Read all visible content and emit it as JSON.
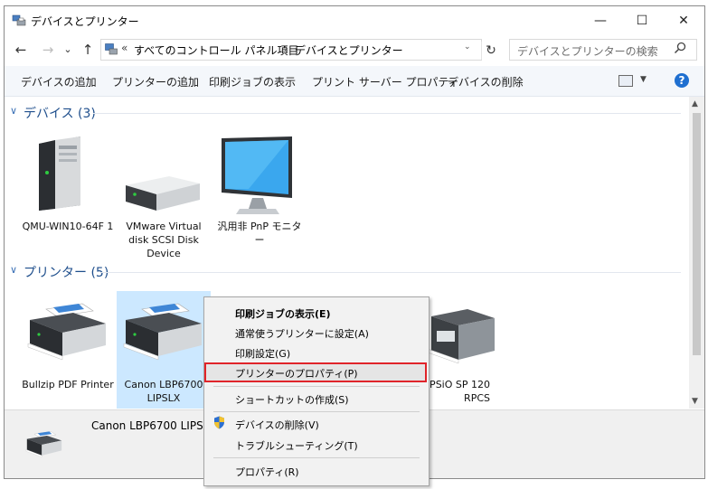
{
  "window": {
    "title": "デバイスとプリンター",
    "minimize_glyph": "—",
    "maximize_glyph": "☐",
    "close_glyph": "✕"
  },
  "nav": {
    "back": "←",
    "forward": "→",
    "recent": "⌄",
    "up": "↑"
  },
  "address": {
    "overflow": "«",
    "crumbs": [
      "すべてのコントロール パネル項目",
      "デバイスとプリンター"
    ],
    "separator": "›",
    "dropdown": "⌄",
    "refresh": "↻"
  },
  "search": {
    "placeholder": "デバイスとプリンターの検索",
    "icon": "search-icon"
  },
  "commands": [
    "デバイスの追加",
    "プリンターの追加",
    "印刷ジョブの表示",
    "プリント サーバー プロパティ",
    "デバイスの削除"
  ],
  "help": "?",
  "groups": {
    "devices": {
      "title": "デバイス (3)",
      "items": [
        {
          "label": "QMU-WIN10-64F 1",
          "icon": "computer-tower-icon"
        },
        {
          "label": "VMware Virtual disk SCSI Disk Device",
          "icon": "disk-drive-icon"
        },
        {
          "label": "汎用非 PnP モニター",
          "icon": "monitor-icon"
        }
      ]
    },
    "printers": {
      "title": "プリンター (5)",
      "items": [
        {
          "label": "Bullzip PDF Printer",
          "icon": "printer-icon"
        },
        {
          "label": "Canon LBP6700 LIPSLX",
          "icon": "printer-icon",
          "selected": true
        },
        {
          "label": "DH IPSiO SP 120 RPCS",
          "icon": "inkjet-printer-icon"
        }
      ]
    }
  },
  "details": {
    "name": "Canon LBP6700 LIPSLX"
  },
  "context_menu": {
    "items": [
      "印刷ジョブの表示(E)",
      "通常使うプリンターに設定(A)",
      "印刷設定(G)",
      "プリンターのプロパティ(P)",
      "ショートカットの作成(S)",
      "デバイスの削除(V)",
      "トラブルシューティング(T)",
      "プロパティ(R)"
    ],
    "highlighted_index": 3,
    "highlight_color": "#e0242a"
  },
  "colors": {
    "accent": "#1e4e8c",
    "selection": "#cce8ff",
    "help": "#1f6fd0"
  }
}
